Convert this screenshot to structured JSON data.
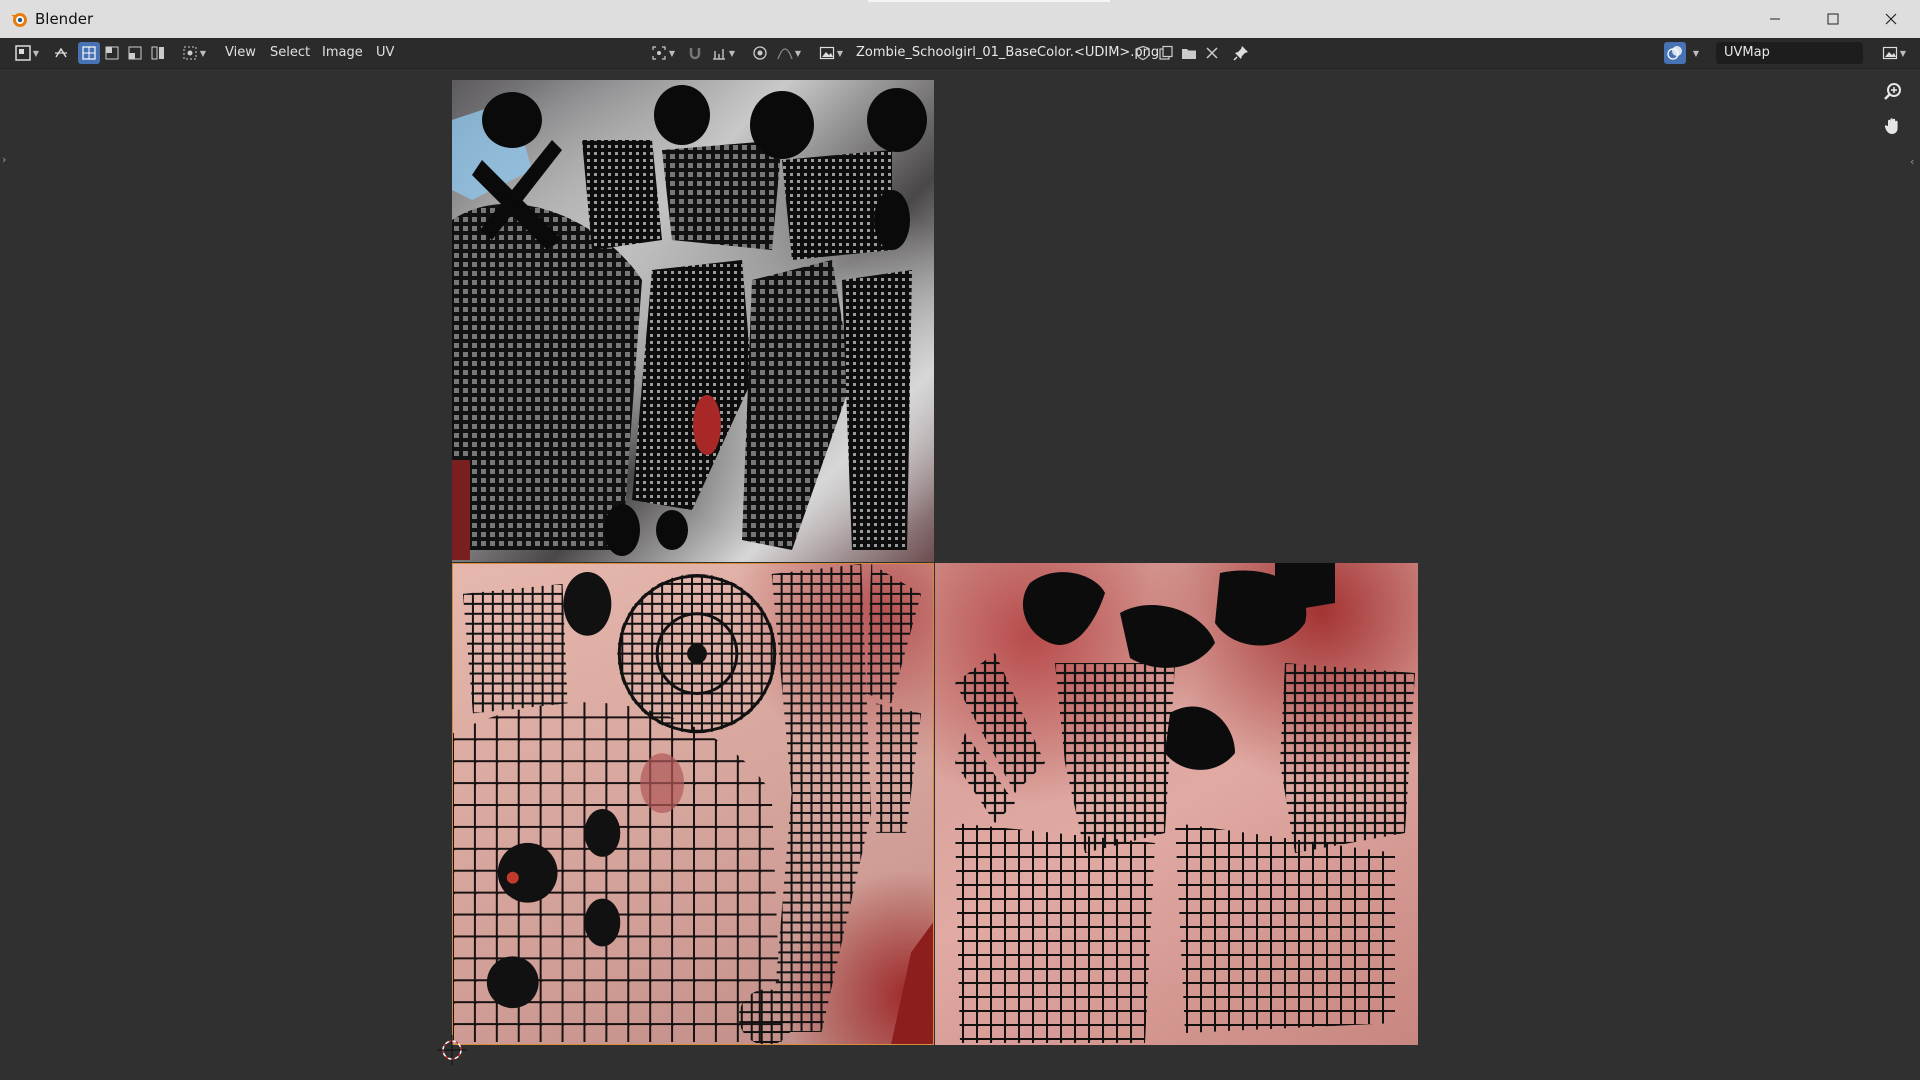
{
  "window": {
    "title": "Blender",
    "minimize_label": "—",
    "maximize_label": "☐",
    "close_label": "✕"
  },
  "header": {
    "menus": [
      "View",
      "Select",
      "Image",
      "UV"
    ],
    "image_name": "Zombie_Schoolgirl_01_BaseColor.<UDIM>.png",
    "uv_map": "UVMap",
    "icons": {
      "editor_type": "uv-editor-icon",
      "sync_selection": "sync-selection-icon",
      "select_modes": [
        "vertex-select-icon",
        "edge-select-icon",
        "face-select-icon",
        "island-select-icon"
      ],
      "sticky_mode": "sticky-select-icon",
      "pivot": "pivot-point-icon",
      "snap": "snap-magnet-icon",
      "snap_target": "snap-target-icon",
      "proportional": "proportional-edit-icon",
      "falloff": "falloff-curve-icon",
      "image_browse": "image-browse-icon",
      "fake_user": "fake-user-shield-icon",
      "new_image": "new-image-icon",
      "open_image": "open-folder-icon",
      "unlink": "unlink-x-icon",
      "pin": "pin-icon",
      "overlays": "overlays-icon",
      "display_channels": "display-channels-icon"
    }
  },
  "viewport": {
    "tools": [
      "zoom-icon",
      "hand-pan-icon"
    ],
    "tiles": [
      "udim-1001",
      "udim-1011",
      "udim-1012"
    ]
  },
  "colors": {
    "accent": "#4772b3",
    "active_tile_border": "#d98a3a",
    "background": "#303030",
    "header": "#2b2b2b",
    "titlebar": "#dedede"
  }
}
